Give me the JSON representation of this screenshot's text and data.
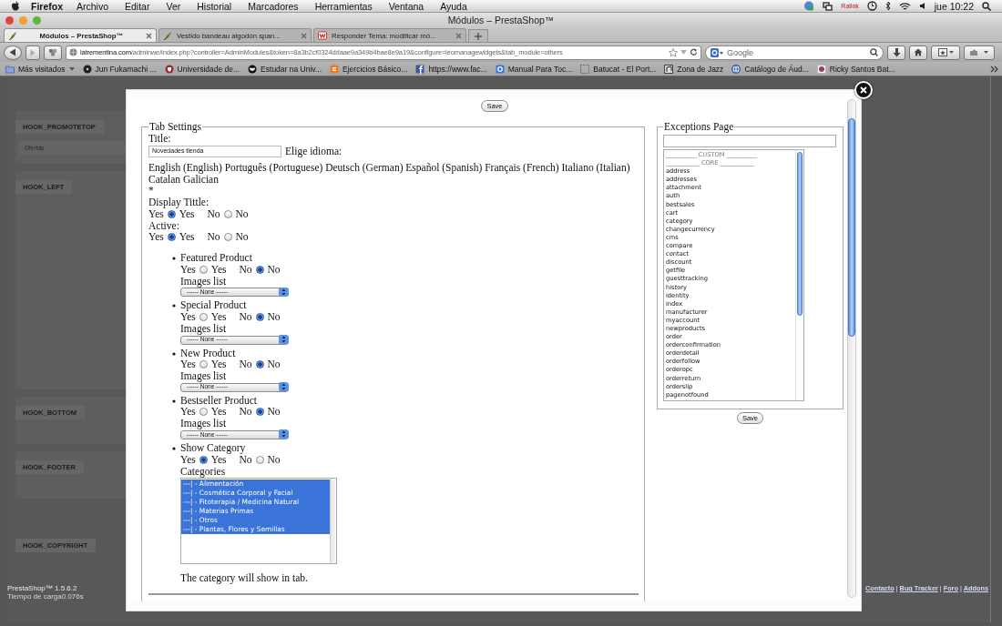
{
  "menubar": {
    "app": "Firefox",
    "menus": [
      "Archivo",
      "Editar",
      "Ver",
      "Historial",
      "Marcadores",
      "Herramientas",
      "Ventana",
      "Ayuda"
    ],
    "network_label": "Ralink",
    "clock": "jue 10:22"
  },
  "window": {
    "title": "Módulos – PrestaShop™"
  },
  "tabs": [
    {
      "label": "Módulos – PrestaShop™",
      "selected": true,
      "kind": "leaf"
    },
    {
      "label": "Vestido bandeau algodón span...",
      "selected": false,
      "kind": "leaf"
    },
    {
      "label": "Responder Tema: modificar mó...",
      "selected": false,
      "kind": "forum"
    }
  ],
  "navbar": {
    "url_host": "latrementina.com",
    "url_path": "/adminwe/index.php?controller=AdminModules&token=8a3b2cf0324ddaae9a349b4bae8e9a19&configure=leomanagewidgets&tab_module=others",
    "search_placeholder": "Google"
  },
  "bookmarks": [
    {
      "label": "Más visitados",
      "kind": "folder"
    },
    {
      "label": "Jun Fukamachi ...",
      "kind": "disc"
    },
    {
      "label": "Universidade de...",
      "kind": "crest"
    },
    {
      "label": "Estudar na Univ...",
      "kind": "mask"
    },
    {
      "label": "Ejercicios Básico...",
      "kind": "blog"
    },
    {
      "label": "https://www.fac...",
      "kind": "social"
    },
    {
      "label": "Manual Para Toc...",
      "kind": "search"
    },
    {
      "label": "Batucat - El Port...",
      "kind": "blank"
    },
    {
      "label": "Zona de Jazz",
      "kind": "note"
    },
    {
      "label": "Catálogo de Áud...",
      "kind": "globe"
    },
    {
      "label": "Ricky Santos Bat...",
      "kind": "badge"
    }
  ],
  "background_page": {
    "hooks": [
      {
        "name": "HOOK_PROMOTETOP",
        "widgets": [
          {
            "name": "Ofertas"
          }
        ]
      },
      {
        "name": "HOOK_LEFT"
      },
      {
        "name": "HOOK_BOTTOM"
      },
      {
        "name": "HOOK_FOOTER"
      },
      {
        "name": "HOOK_COPYRIGHT"
      }
    ],
    "version": "PrestaShop™ 1.5.6.2",
    "load_time": "Tiempo de carga0.076s",
    "links": [
      {
        "label": "Contacto",
        "kind": "link"
      },
      {
        "label": "|",
        "kind": "separator"
      },
      {
        "label": "Bug Tracker",
        "kind": "link"
      },
      {
        "label": "|",
        "kind": "separator"
      },
      {
        "label": "Foro",
        "kind": "link"
      },
      {
        "label": "|",
        "kind": "separator"
      },
      {
        "label": "Addons",
        "kind": "link"
      }
    ]
  },
  "modal": {
    "save_label": "Save",
    "tab_settings": {
      "legend": "Tab Settings",
      "title_label": "Title:",
      "title_value": "Novedades tienda",
      "language_label": "Elige idioma:",
      "languages": "English (English) Português (Portuguese) Deutsch (German) Español (Spanish) Français (French) Italiano (Italian) Catalan Galician",
      "required_mark": "*",
      "toggles": [
        {
          "label": "Display Tittle:",
          "options": [
            {
              "before": "Yes",
              "after": "Yes",
              "selected": true
            },
            {
              "before": "No",
              "after": "No",
              "selected": false
            }
          ]
        },
        {
          "label": "Active:",
          "options": [
            {
              "before": "Yes",
              "after": "Yes",
              "selected": true
            },
            {
              "before": "No",
              "after": "No",
              "selected": false
            }
          ]
        }
      ],
      "sections": [
        {
          "kind": "images",
          "title": "Featured Product",
          "options": [
            {
              "before": "Yes",
              "after": "Yes",
              "selected": false
            },
            {
              "before": "No",
              "after": "No",
              "selected": true
            }
          ],
          "list_label": "Images list",
          "list_value": "------ None ------"
        },
        {
          "kind": "images",
          "title": "Special Product",
          "options": [
            {
              "before": "Yes",
              "after": "Yes",
              "selected": false
            },
            {
              "before": "No",
              "after": "No",
              "selected": true
            }
          ],
          "list_label": "Images list",
          "list_value": "------ None ------"
        },
        {
          "kind": "images",
          "title": "New Product",
          "options": [
            {
              "before": "Yes",
              "after": "Yes",
              "selected": false
            },
            {
              "before": "No",
              "after": "No",
              "selected": true
            }
          ],
          "list_label": "Images list",
          "list_value": "------ None ------"
        },
        {
          "kind": "images",
          "title": "Bestseller Product",
          "options": [
            {
              "before": "Yes",
              "after": "Yes",
              "selected": false
            },
            {
              "before": "No",
              "after": "No",
              "selected": true
            }
          ],
          "list_label": "Images list",
          "list_value": "------ None ------"
        },
        {
          "kind": "categories",
          "title": "Show Category",
          "options": [
            {
              "before": "Yes",
              "after": "Yes",
              "selected": true
            },
            {
              "before": "No",
              "after": "No",
              "selected": false
            }
          ],
          "list_label": "Categories",
          "categories": [
            {
              "label": "---| - Alimentación",
              "selected": true
            },
            {
              "label": "---| - Cosmética Corporal y Facial",
              "selected": true
            },
            {
              "label": "---| - Fitoterapia / Medicina Natural",
              "selected": true
            },
            {
              "label": "---| - Materias Primas",
              "selected": true
            },
            {
              "label": "---| - Otros",
              "selected": true
            },
            {
              "label": "---| - Plantas, Flores y Semillas",
              "selected": true
            }
          ],
          "note": "The category will show in tab."
        }
      ]
    },
    "exceptions": {
      "legend": "Exceptions Page",
      "save_label": "Save",
      "pages": [
        {
          "label": "__________ CUSTOM __________",
          "kind": "group"
        },
        {
          "label": "___________ CORE ___________",
          "kind": "group"
        },
        {
          "label": "address",
          "kind": "page"
        },
        {
          "label": "addresses",
          "kind": "page"
        },
        {
          "label": "attachment",
          "kind": "page"
        },
        {
          "label": "auth",
          "kind": "page"
        },
        {
          "label": "bestsales",
          "kind": "page"
        },
        {
          "label": "cart",
          "kind": "page"
        },
        {
          "label": "category",
          "kind": "page"
        },
        {
          "label": "changecurrency",
          "kind": "page"
        },
        {
          "label": "cms",
          "kind": "page"
        },
        {
          "label": "compare",
          "kind": "page"
        },
        {
          "label": "contact",
          "kind": "page"
        },
        {
          "label": "discount",
          "kind": "page"
        },
        {
          "label": "getfile",
          "kind": "page"
        },
        {
          "label": "guesttracking",
          "kind": "page"
        },
        {
          "label": "history",
          "kind": "page"
        },
        {
          "label": "identity",
          "kind": "page"
        },
        {
          "label": "index",
          "kind": "page"
        },
        {
          "label": "manufacturer",
          "kind": "page"
        },
        {
          "label": "myaccount",
          "kind": "page"
        },
        {
          "label": "newproducts",
          "kind": "page"
        },
        {
          "label": "order",
          "kind": "page"
        },
        {
          "label": "orderconfirmation",
          "kind": "page"
        },
        {
          "label": "orderdetail",
          "kind": "page"
        },
        {
          "label": "orderfollow",
          "kind": "page"
        },
        {
          "label": "orderopc",
          "kind": "page"
        },
        {
          "label": "orderreturn",
          "kind": "page"
        },
        {
          "label": "orderslip",
          "kind": "page"
        },
        {
          "label": "pagenotfound",
          "kind": "page"
        }
      ]
    }
  }
}
